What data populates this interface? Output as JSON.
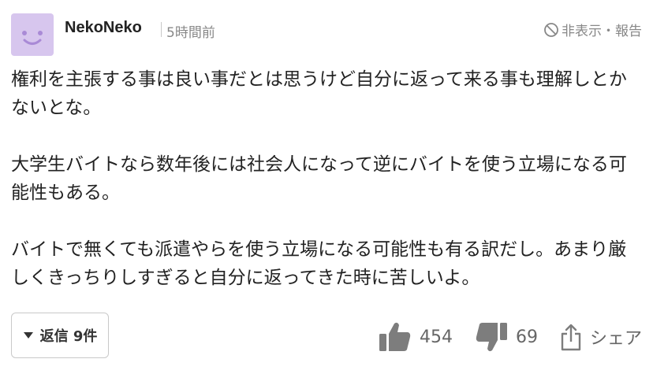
{
  "comment": {
    "user": {
      "name": "NekoNeko"
    },
    "time": "5時間前",
    "hide_report_label": "非表示・報告",
    "paragraphs": [
      "権利を主張する事は良い事だとは思うけど自分に返って来る事も理解しとかないとな。",
      "大学生バイトなら数年後には社会人になって逆にバイトを使う立場になる可能性もある。",
      "バイトで無くても派遣やらを使う立場になる可能性も有る訳だし。あまり厳しくきっちりしすぎると自分に返ってきた時に苦しいよ。"
    ],
    "reply_label": "返信 9件",
    "likes": "454",
    "dislikes": "69",
    "share_label": "シェア"
  },
  "colors": {
    "avatar_bg": "#d7c6ee",
    "avatar_face": "#a98ad6",
    "icon_gray": "#7d7d7d",
    "text": "#222222",
    "muted": "#888888"
  },
  "icons": [
    "avatar-face-icon",
    "ban-icon",
    "caret-down-icon",
    "thumbs-up-icon",
    "thumbs-down-icon",
    "share-icon"
  ]
}
